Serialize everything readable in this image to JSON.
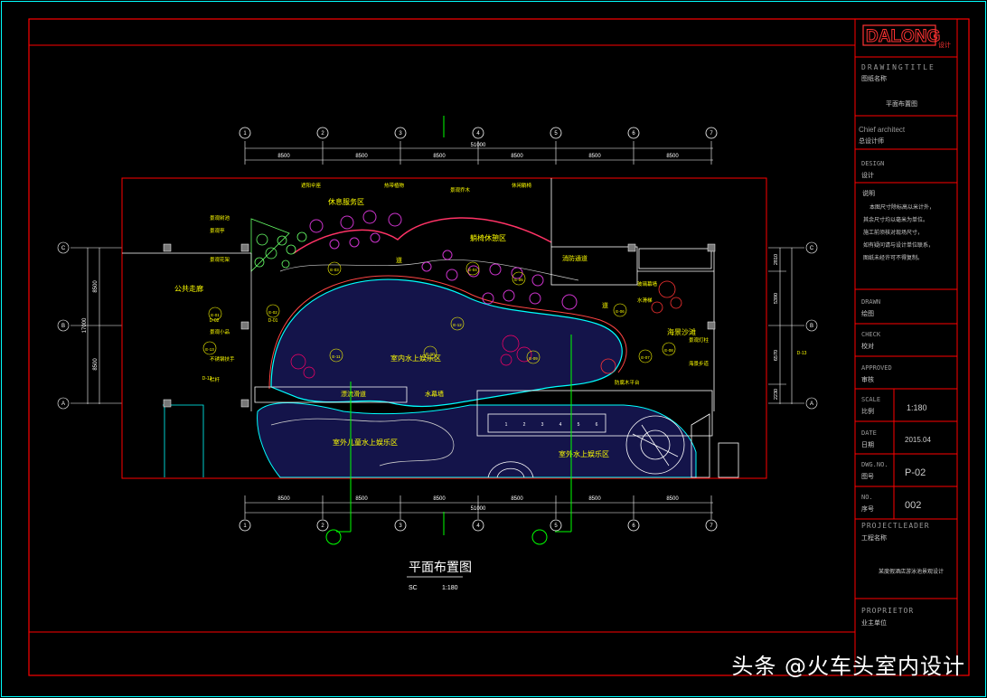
{
  "title_block": {
    "logo_text": "DALONG",
    "logo_sub": "设计",
    "drawing_title_en": "DRAWINGTITLE",
    "drawing_title_cn": "图纸名称",
    "drawing_title_value": "平面布置图",
    "chief_architect_en": "Chief architect",
    "chief_architect_cn": "总设计师",
    "design_en": "DESIGN",
    "design_cn": "设计",
    "notes_heading": "说明",
    "notes_lines": [
      "本图尺寸除标高以米计外，",
      "其余尺寸均以毫米为单位。",
      "施工前须核对现场尺寸，",
      "如有疑问请与设计单位联系，",
      "图纸未经许可不得复制。"
    ],
    "drawn_en": "DRAWN",
    "drawn_cn": "绘图",
    "check_en": "CHECK",
    "check_cn": "校对",
    "approved_en": "APPROVED",
    "approved_cn": "审核",
    "scale_en": "SCALE",
    "scale_cn": "比例",
    "scale_value": "1:180",
    "date_en": "DATE",
    "date_cn": "日期",
    "date_value": "2015.04",
    "dwg_en": "DWG.NO.",
    "dwg_cn": "图号",
    "dwg_value": "P-02",
    "no_en": "NO.",
    "no_cn": "序号",
    "no_value": "002",
    "project_leader_en": "PROJECTLEADER",
    "project_leader_cn": "工程名称",
    "project_name": "某度假酒店游泳池景观设计",
    "proprietor_en": "PROPRIETOR",
    "proprietor_cn": "业主单位"
  },
  "plan": {
    "title": "平面布置图",
    "scale_label": "SC",
    "scale_value": "1:180",
    "top_dims": [
      "8500",
      "8500",
      "8500",
      "8500",
      "8500",
      "8500"
    ],
    "top_total": "51000",
    "bottom_dims": [
      "8500",
      "8500",
      "8500",
      "8500",
      "8500",
      "8500"
    ],
    "bottom_total": "51000",
    "col_bubbles": [
      "1",
      "2",
      "3",
      "4",
      "5",
      "6",
      "7"
    ],
    "row_bubbles": [
      "C",
      "B",
      "A"
    ],
    "left_dims": [
      "8500",
      "8500"
    ],
    "left_total": "17000",
    "right_dims": [
      "2810",
      "5390",
      "6570",
      "2230"
    ],
    "zones": {
      "leisure": "休息服务区",
      "lounge": "躺椅休憩区",
      "fire_lane": "消防通道",
      "public_walk": "公共走廊",
      "indoor_pool": "室内水上娱乐区",
      "outdoor_kids": "室外儿童水上娱乐区",
      "outdoor_pool": "室外水上娱乐区",
      "beach": "海景沙滩",
      "water_slide": "漂流滑道",
      "water_curtain": "水幕墙",
      "path": "道",
      "path2": "道"
    },
    "callouts": [
      "遮阳伞座",
      "热带植物",
      "景观乔木",
      "休闲躺椅",
      "景观树池",
      "景观亭",
      "景观花架",
      "景观小品",
      "不锈钢扶手",
      "栏杆",
      "玻璃幕墙",
      "水滑梯",
      "景观灯柱",
      "海景步道",
      "防腐木平台"
    ],
    "elev_labels": [
      "E-01",
      "E-02",
      "E-03",
      "E-04",
      "E-05",
      "E-06",
      "E-07",
      "E-08",
      "E-09",
      "E-10",
      "E-11",
      "E-12",
      "E-13"
    ],
    "section_marks": [
      "D-13",
      "D-13",
      "D-02",
      "D-01"
    ],
    "grate_labels": [
      "1",
      "2",
      "3",
      "4",
      "5",
      "6"
    ]
  },
  "watermark": "头条 @火车头室内设计",
  "colors": {
    "background": "#000000",
    "frame": "#ff0000",
    "dim": "#ffffff",
    "label": "#ffff00",
    "water": "#14144a",
    "section": "#00ff00",
    "cyan": "#00ffff"
  }
}
